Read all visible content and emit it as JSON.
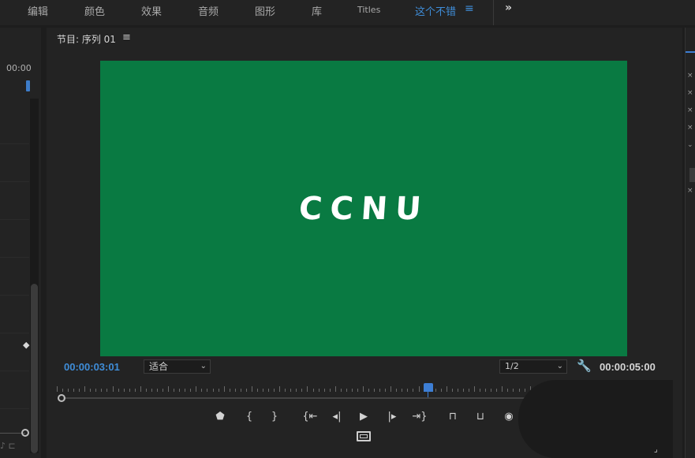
{
  "workspace": {
    "tabs": [
      "编辑",
      "颜色",
      "效果",
      "音频",
      "图形",
      "库",
      "Titles",
      "这个不错"
    ],
    "active_tab": "这个不错",
    "menu_icon": "hamburger-icon",
    "overflow_label": "»"
  },
  "left_panel": {
    "timecode": "00:00"
  },
  "program_monitor": {
    "title": "节目: 序列 01",
    "menu_icon": "≡",
    "preview_text": "CCNU",
    "preview_bg": "#097a42",
    "current_time": "00:00:03:01",
    "zoom_value": "适合",
    "resolution_value": "1/2",
    "duration": "00:00:05:00",
    "playhead_fraction": 0.6
  },
  "controls": [
    {
      "name": "add-marker-button",
      "glyph": "⬟"
    },
    {
      "name": "mark-in-button",
      "glyph": "{"
    },
    {
      "name": "mark-out-button",
      "glyph": "}"
    },
    {
      "name": "go-to-in-button",
      "glyph": "{⇤"
    },
    {
      "name": "step-back-button",
      "glyph": "◂|"
    },
    {
      "name": "play-button",
      "glyph": "▶"
    },
    {
      "name": "step-forward-button",
      "glyph": "|▸"
    },
    {
      "name": "go-to-out-button",
      "glyph": "⇥}"
    },
    {
      "name": "lift-button",
      "glyph": "⊓"
    },
    {
      "name": "extract-button",
      "glyph": "⊔"
    },
    {
      "name": "export-frame-button",
      "glyph": "◉"
    }
  ],
  "colors": {
    "accent": "#3f8dd8",
    "panel": "#232323",
    "background": "#1d1d1d"
  }
}
